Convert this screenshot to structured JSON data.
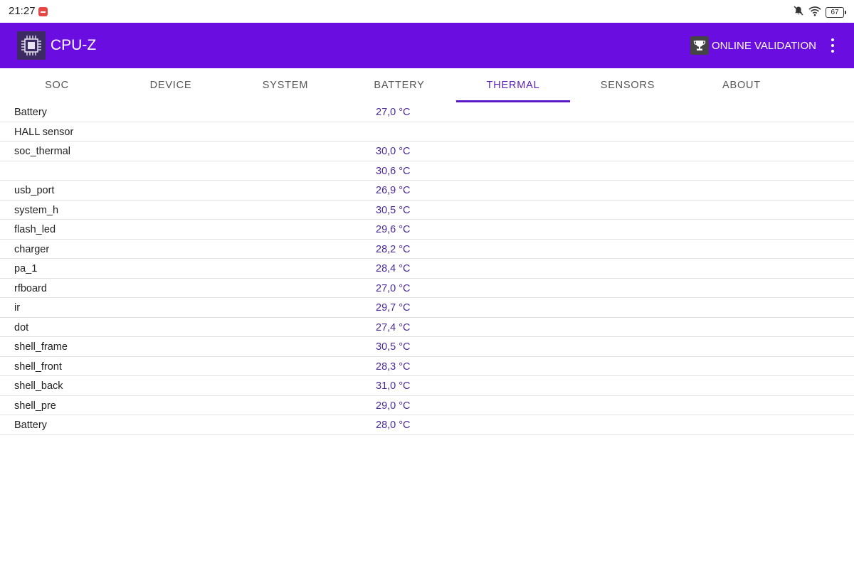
{
  "status_bar": {
    "time": "21:27",
    "battery_level": "67",
    "icons": [
      "app-notification-icon",
      "mute-icon",
      "wifi-icon",
      "battery-icon"
    ]
  },
  "app_bar": {
    "title": "CPU-Z",
    "logo_icon": "cpu-chip-icon",
    "validation_label": "ONLINE VALIDATION",
    "validation_icon": "trophy-icon",
    "menu_icon": "more-vertical-icon",
    "color": "#6a0de0"
  },
  "tabs": [
    {
      "label": "SOC"
    },
    {
      "label": "DEVICE"
    },
    {
      "label": "SYSTEM"
    },
    {
      "label": "BATTERY"
    },
    {
      "label": "THERMAL",
      "active": true
    },
    {
      "label": "SENSORS"
    },
    {
      "label": "ABOUT"
    }
  ],
  "accent_color": "#5a18c9",
  "thermal_rows": [
    {
      "name": "Battery",
      "value": "27,0 °C"
    },
    {
      "name": "HALL sensor",
      "value": ""
    },
    {
      "name": "soc_thermal",
      "value": "30,0 °C"
    },
    {
      "name": "",
      "value": "30,6 °C"
    },
    {
      "name": "usb_port",
      "value": "26,9 °C"
    },
    {
      "name": "system_h",
      "value": "30,5 °C"
    },
    {
      "name": "flash_led",
      "value": "29,6 °C"
    },
    {
      "name": "charger",
      "value": "28,2 °C"
    },
    {
      "name": "pa_1",
      "value": "28,4 °C"
    },
    {
      "name": "rfboard",
      "value": "27,0 °C"
    },
    {
      "name": "ir",
      "value": "29,7 °C"
    },
    {
      "name": "dot",
      "value": "27,4 °C"
    },
    {
      "name": "shell_frame",
      "value": "30,5 °C"
    },
    {
      "name": "shell_front",
      "value": "28,3 °C"
    },
    {
      "name": "shell_back",
      "value": "31,0 °C"
    },
    {
      "name": "shell_pre",
      "value": "29,0 °C"
    },
    {
      "name": "Battery",
      "value": "28,0 °C"
    }
  ]
}
